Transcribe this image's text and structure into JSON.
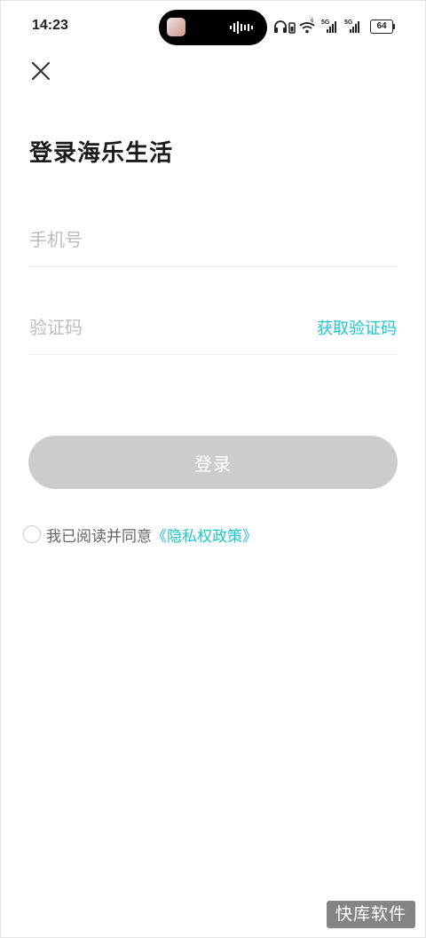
{
  "status_bar": {
    "time": "14:23",
    "battery": "64",
    "network_1": "5G",
    "network_2": "5G"
  },
  "header": {
    "close_icon": "close-icon"
  },
  "title": "登录海乐生活",
  "phone_field": {
    "placeholder": "手机号",
    "value": ""
  },
  "code_field": {
    "placeholder": "验证码",
    "value": "",
    "get_code_label": "获取验证码"
  },
  "login_button": {
    "label": "登录"
  },
  "agreement": {
    "text": "我已阅读并同意",
    "link": "《隐私权政策》",
    "checked": false
  },
  "watermark": "快库软件",
  "colors": {
    "accent": "#1fc5cf",
    "button_disabled": "#cccccc",
    "placeholder": "#bdbdbd"
  }
}
